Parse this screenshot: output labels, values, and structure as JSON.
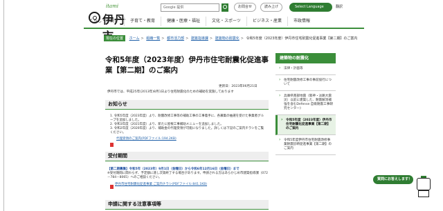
{
  "header": {
    "logo_small": "itami",
    "logo_city": "伊丹市",
    "search_engine": "Google 提供",
    "readspeaker_label": "お問合せ",
    "readaloud_label": "読み上げ",
    "language_label": "Select Language",
    "translate_label": "翻訳"
  },
  "nav": {
    "items": [
      "くらし・手続き",
      "子育て・教育",
      "健康・医療・福祉",
      "文化・スポーツ",
      "ビジネス・産業",
      "市政情報"
    ]
  },
  "breadcrumb": {
    "here_label": "現在の位置",
    "items": [
      "ホーム",
      "組織一覧",
      "都市活力部",
      "建築指導課",
      "建築物の耐震化"
    ],
    "current": "令和5年度（2023年度）伊丹市住宅耐震化促進事業【第二期】のご案内"
  },
  "page": {
    "title": "令和5年度（2023年度）伊丹市住宅耐震化促進事業【第二期】のご案内",
    "updated": "更新日：2023年06月21日",
    "intro": "伊丹市では、平成25年(2013年)8月1日より住宅耐震化のための補助を実施しております"
  },
  "notice": {
    "heading": "お知らせ",
    "items": [
      "1. 令和5年度（2023年度）より、耐震改修工事等の補助工事の工事着手に、各募集の抽選を受けた事業者グループを追加しました。",
      "2. 令和3年度（2021年度）より、新たに屋根工事補助メニューを追加しました。",
      "3. 令和2年度（2020年度）より、補助金の代理受領が可能になりました。詳しくは下記のご案内チラシをご覧ください。"
    ],
    "link": "代理受領のご案内(PDFファイル:194.2KB)"
  },
  "reception": {
    "heading": "受付期間",
    "period": "【第二期募集】令和5年（2023年）9月1日（金曜日）から令和6年12月16日（金曜日）まで",
    "note": "※受付期間に関わらず、予定額に達し次第終了する場合があります。申請される方はあらかじめ市建築指導課（072－784－8065）へのご相談ください。",
    "link": "伊丹市住宅耐震化促進事業 ご案内チラシ(PDFファイル:841.1KB)"
  },
  "application": {
    "heading": "申請に関する注意事項等"
  },
  "sidebar": {
    "heading": "建築物の耐震化",
    "items": [
      "法律・計画等",
      "住宅耐震改修工事の事前協行について",
      "兵庫県南部地震（阪神・淡路大震災）以前に建築した、耐震解消補強を含むDefense 自衛耐震工事研究センター)",
      "令和5年度（2023年度）伊丹市住宅耐震化促進事業【第二期】のご案内",
      "令和5年度伊丹市住宅耐震改修事業耐震診断促進事業【第二期】のご案内"
    ]
  },
  "chat": {
    "label": "質問にお答えします！"
  },
  "colors": {
    "brand_green": "#3b8e3a",
    "link_blue": "#1e5fa8",
    "alert_red": "#dd0000"
  }
}
